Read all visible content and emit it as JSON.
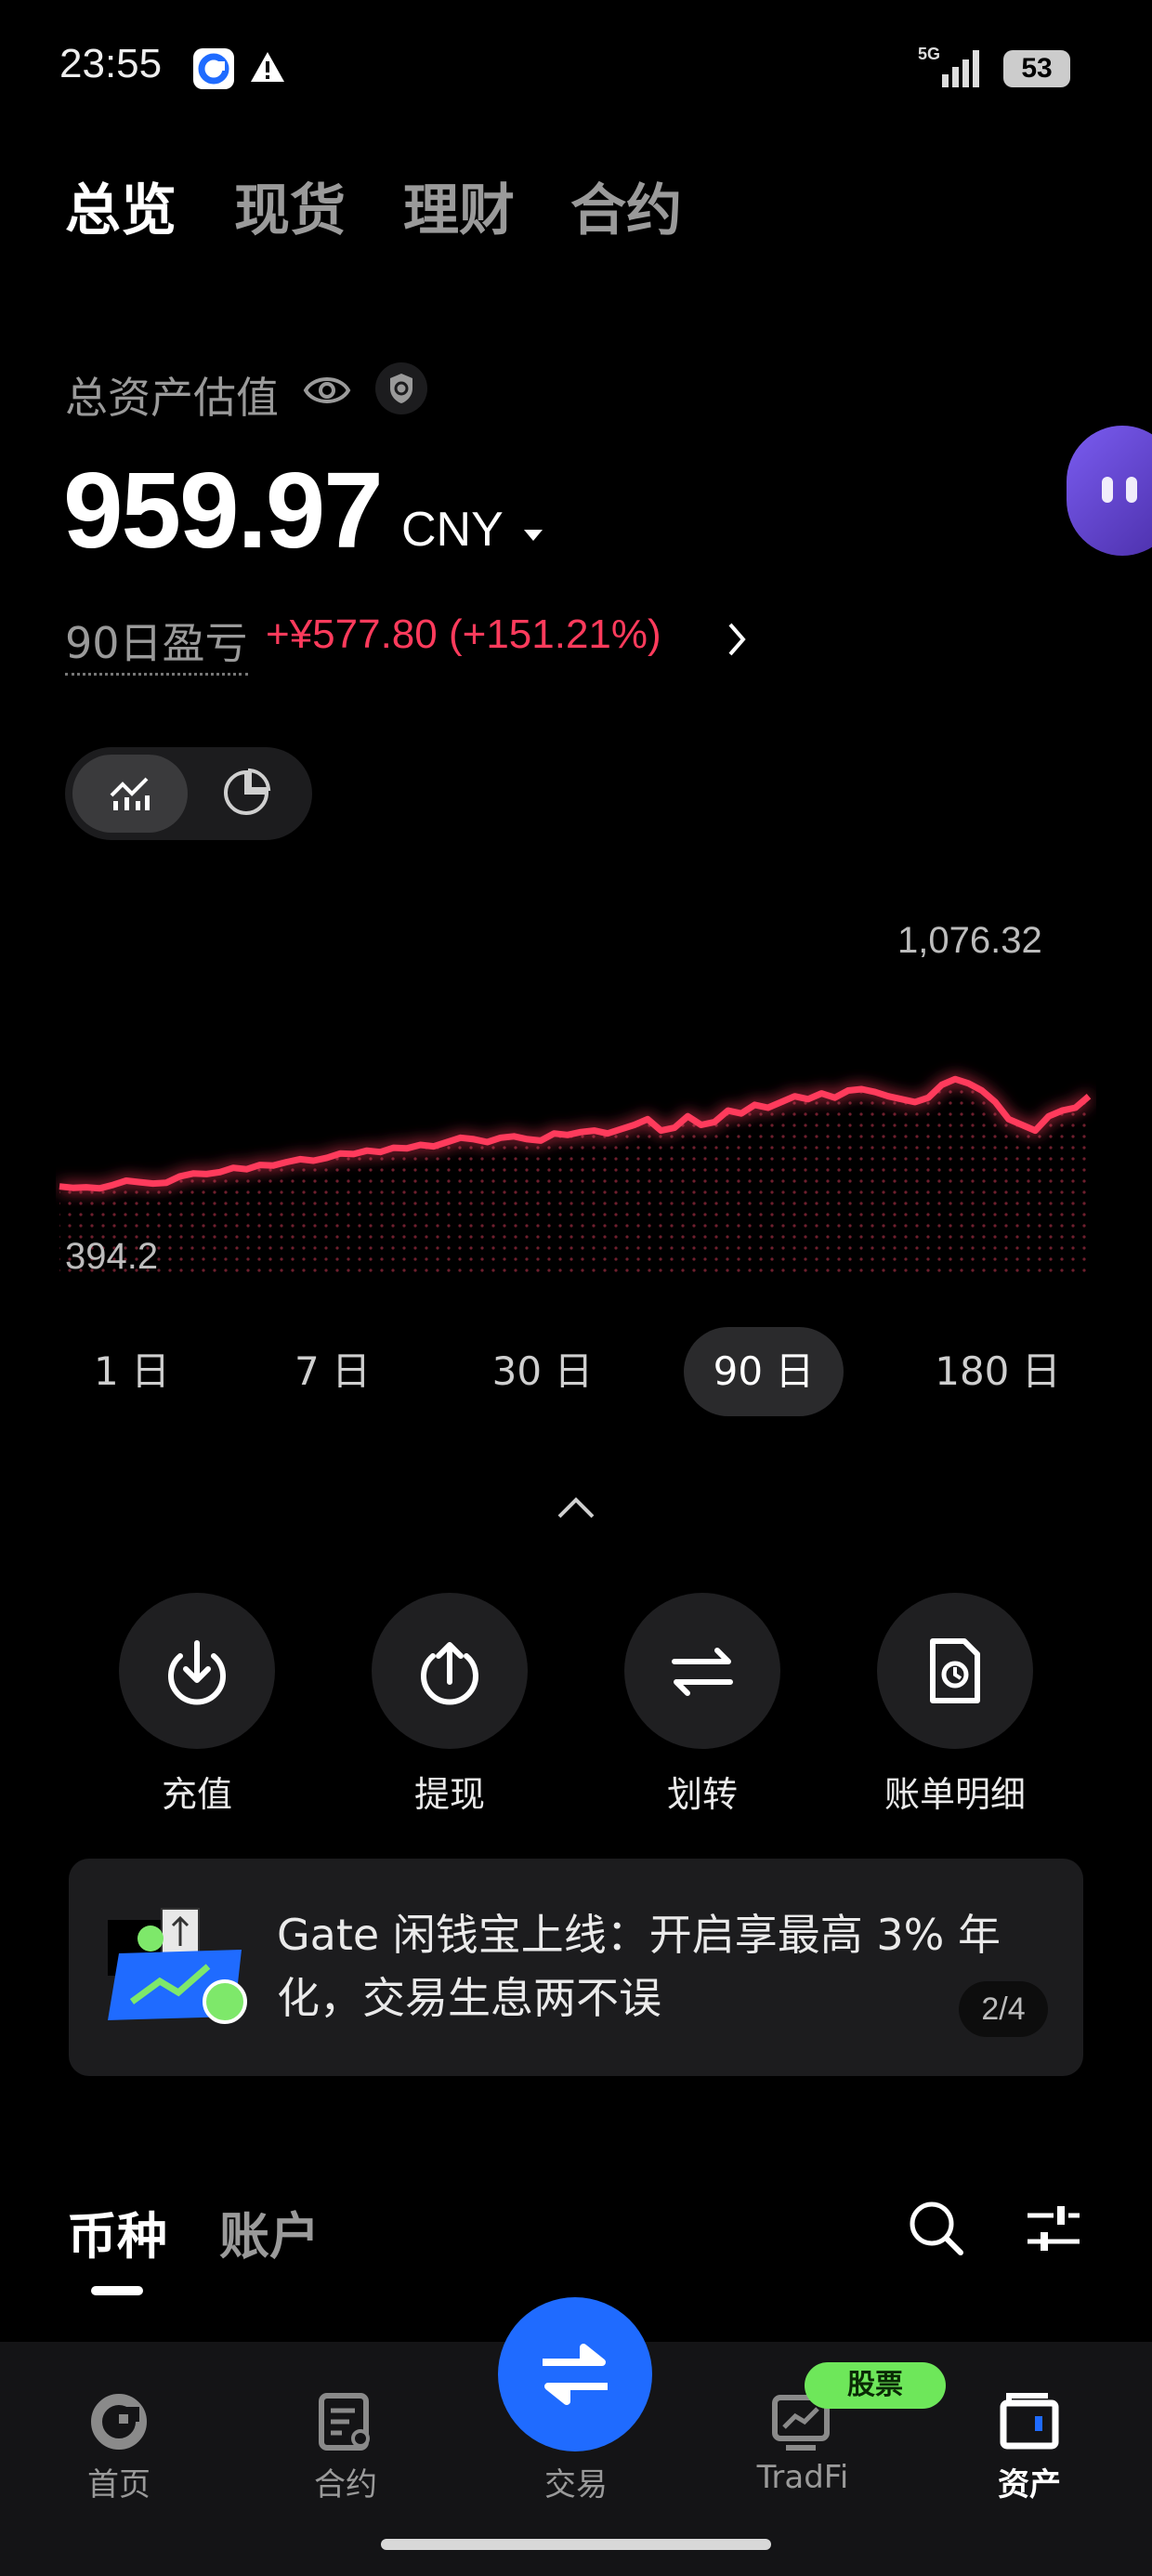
{
  "status_bar": {
    "time": "23:55",
    "network": "5G",
    "battery": "53"
  },
  "top_tabs": [
    {
      "label": "总览"
    },
    {
      "label": "现货"
    },
    {
      "label": "理财"
    },
    {
      "label": "合约"
    }
  ],
  "assets": {
    "label": "总资产估值",
    "value": "959.97",
    "currency": "CNY",
    "pnl_label": "90日盈亏",
    "pnl_value": "+¥577.80 (+151.21%)"
  },
  "chart_data": {
    "type": "line",
    "max_label": "1,076.32",
    "min_label": "394.2",
    "ylim": [
      394.2,
      1076.32
    ],
    "color": "#ff3b5c",
    "values": [
      405,
      400,
      402,
      398,
      410,
      425,
      420,
      415,
      418,
      440,
      450,
      448,
      455,
      470,
      465,
      480,
      478,
      490,
      500,
      495,
      505,
      520,
      518,
      530,
      525,
      540,
      538,
      550,
      545,
      560,
      575,
      570,
      560,
      575,
      580,
      570,
      565,
      590,
      585,
      595,
      600,
      590,
      605,
      620,
      640,
      600,
      610,
      650,
      620,
      630,
      670,
      660,
      690,
      680,
      700,
      720,
      710,
      730,
      715,
      740,
      745,
      735,
      720,
      710,
      700,
      715,
      760,
      780,
      765,
      740,
      700,
      640,
      620,
      600,
      650,
      670,
      680,
      720
    ]
  },
  "periods": [
    {
      "label": "1 日"
    },
    {
      "label": "7 日"
    },
    {
      "label": "30 日"
    },
    {
      "label": "90 日"
    },
    {
      "label": "180 日"
    }
  ],
  "actions": [
    {
      "label": "充值",
      "icon": "deposit-icon"
    },
    {
      "label": "提现",
      "icon": "withdraw-icon"
    },
    {
      "label": "划转",
      "icon": "transfer-icon"
    },
    {
      "label": "账单明细",
      "icon": "bill-icon"
    }
  ],
  "banner": {
    "text": "Gate 闲钱宝上线：开启享最高 3% 年化，交易生息两不误",
    "page": "2/4"
  },
  "list_tabs": [
    {
      "label": "币种"
    },
    {
      "label": "账户"
    }
  ],
  "bottom_nav": [
    {
      "label": "首页",
      "icon": "home-icon"
    },
    {
      "label": "合约",
      "icon": "futures-icon"
    },
    {
      "label": "交易",
      "icon": "trade-icon"
    },
    {
      "label": "TradFi",
      "icon": "tradfi-icon",
      "badge": "股票"
    },
    {
      "label": "资产",
      "icon": "wallet-icon"
    }
  ]
}
